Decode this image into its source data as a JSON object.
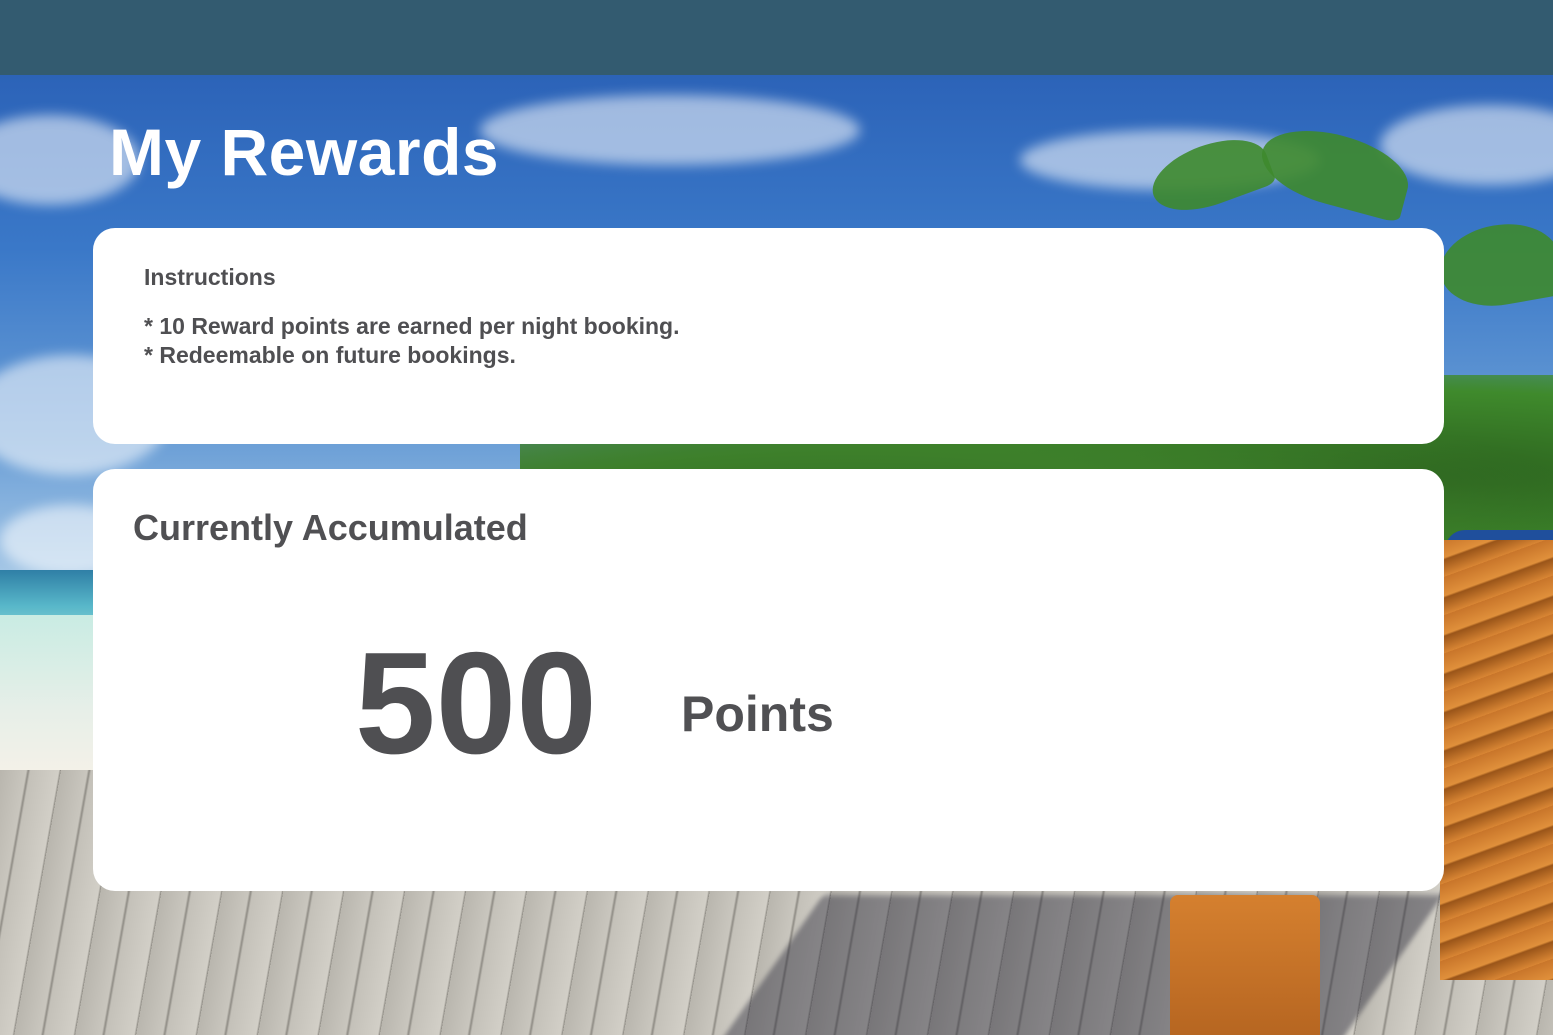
{
  "page": {
    "title": "My Rewards"
  },
  "instructions": {
    "heading": "Instructions",
    "lines": [
      "* 10 Reward points are earned per night booking.",
      "* Redeemable on future bookings."
    ]
  },
  "rewards": {
    "heading": "Currently Accumulated",
    "points": "500",
    "unit": "Points"
  },
  "colors": {
    "topbar": "#335b70",
    "card": "#ffffff",
    "text": "#4f4f52",
    "title": "#ffffff"
  }
}
